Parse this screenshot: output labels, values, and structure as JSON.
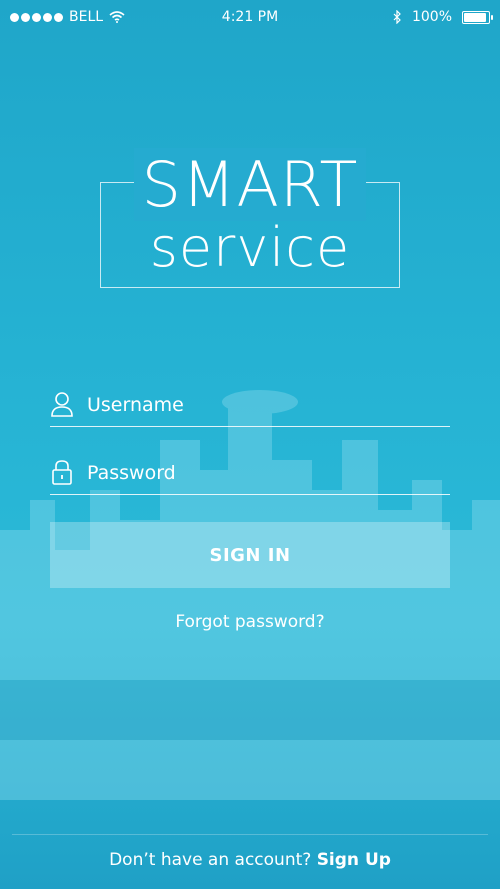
{
  "status_bar": {
    "carrier": "BELL",
    "time": "4:21 PM",
    "battery": "100%",
    "battery_level": 1.0
  },
  "logo": {
    "line1": "SMART",
    "line2": "service"
  },
  "form": {
    "username_placeholder": "Username",
    "password_placeholder": "Password",
    "signin_label": "SIGN IN",
    "forgot_label": "Forgot password?"
  },
  "footer": {
    "prompt": "Don’t have an account?",
    "signup_label": "Sign Up"
  },
  "icons": {
    "signal": "signal-dots-icon",
    "wifi": "wifi-icon",
    "bluetooth": "bluetooth-icon",
    "battery": "battery-icon",
    "user": "user-icon",
    "lock": "lock-icon",
    "skyline": "city-skyline-background"
  },
  "colors": {
    "background": "#25b2d3",
    "text": "#ffffff"
  }
}
